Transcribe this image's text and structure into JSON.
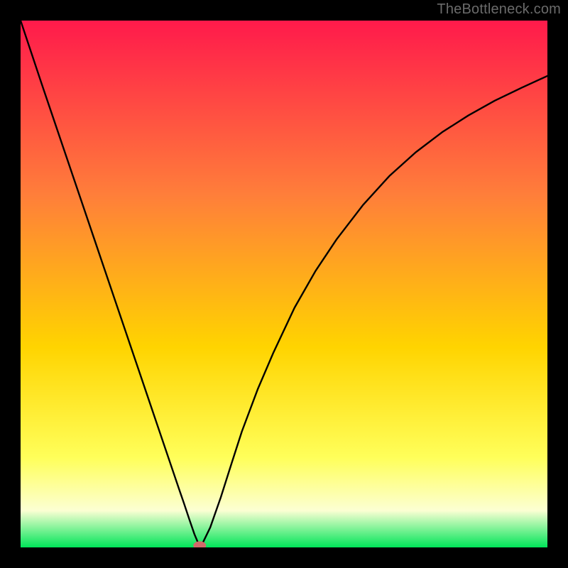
{
  "attribution": "TheBottleneck.com",
  "colors": {
    "frame": "#000000",
    "gradient_top": "#ff1a4b",
    "gradient_upper_mid": "#ff7e3a",
    "gradient_mid": "#ffd400",
    "gradient_lower_mid": "#ffff5a",
    "gradient_pale": "#fcffd3",
    "gradient_bottom": "#00e559",
    "curve": "#000000",
    "marker_fill": "#d16a6a",
    "marker_stroke": "#9e4a4a"
  },
  "chart_data": {
    "type": "line",
    "title": "",
    "xlabel": "",
    "ylabel": "",
    "xlim": [
      0,
      100
    ],
    "ylim": [
      0,
      100
    ],
    "grid": false,
    "series": [
      {
        "name": "bottleneck-curve",
        "x": [
          0,
          2,
          4,
          6,
          8,
          10,
          12,
          14,
          16,
          18,
          20,
          22,
          24,
          26,
          28,
          30,
          31,
          32,
          33,
          33.8,
          34.5,
          36,
          38,
          40,
          42,
          45,
          48,
          52,
          56,
          60,
          65,
          70,
          75,
          80,
          85,
          90,
          95,
          100
        ],
        "y": [
          100,
          94,
          88,
          82.1,
          76.2,
          70.3,
          64.4,
          58.5,
          52.6,
          46.7,
          40.8,
          34.9,
          29,
          23.1,
          17.2,
          11.3,
          8.4,
          5.4,
          2.5,
          0.6,
          0.7,
          3.8,
          9.5,
          15.8,
          22,
          30,
          37,
          45.5,
          52.5,
          58.5,
          65,
          70.5,
          75,
          78.8,
          82,
          84.8,
          87.2,
          89.5
        ]
      }
    ],
    "marker": {
      "x": 34,
      "y": 0.35
    },
    "legend": null,
    "annotations": []
  }
}
